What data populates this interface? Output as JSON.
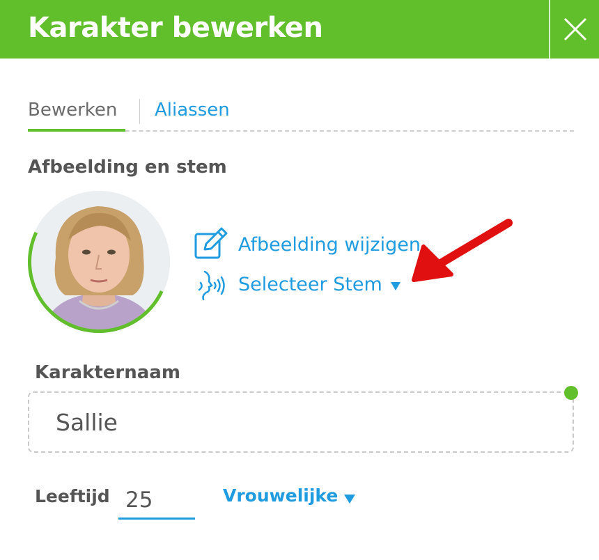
{
  "dialog": {
    "title": "Karakter bewerken",
    "close_icon": "close-icon"
  },
  "tabs": {
    "edit": "Bewerken",
    "aliases": "Aliassen",
    "active": "Bewerken"
  },
  "image_voice": {
    "section_title": "Afbeelding en stem",
    "change_image": "Afbeelding wijzigen",
    "change_image_icon": "edit-icon",
    "select_voice": "Selecteer Stem",
    "select_voice_icon": "voice-icon"
  },
  "character": {
    "name_label": "Karakternaam",
    "name_value": "Sallie",
    "age_label": "Leeftijd",
    "age_value": "25",
    "gender_value": "Vrouwelijke"
  },
  "colors": {
    "brand_green": "#62bf2c",
    "link_blue": "#1f9be0",
    "annotation_red": "#e01010"
  }
}
